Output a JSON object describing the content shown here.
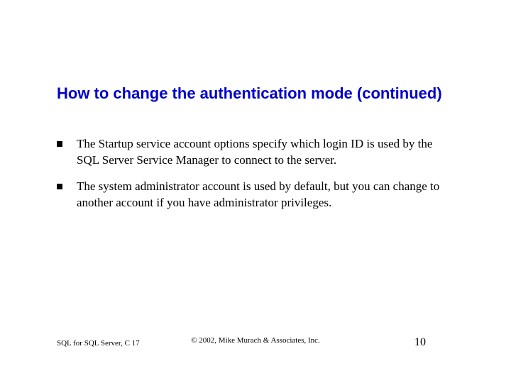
{
  "title": "How to change the authentication mode (continued)",
  "bullets": [
    "The Startup service account options specify which login ID is used by the SQL Server Service Manager to connect to the server.",
    "The system administrator account is used by default, but you can change to another account if you have administrator privileges."
  ],
  "footer": {
    "left": "SQL for SQL Server, C 17",
    "center": "© 2002, Mike Murach & Associates, Inc.",
    "page": "10"
  }
}
